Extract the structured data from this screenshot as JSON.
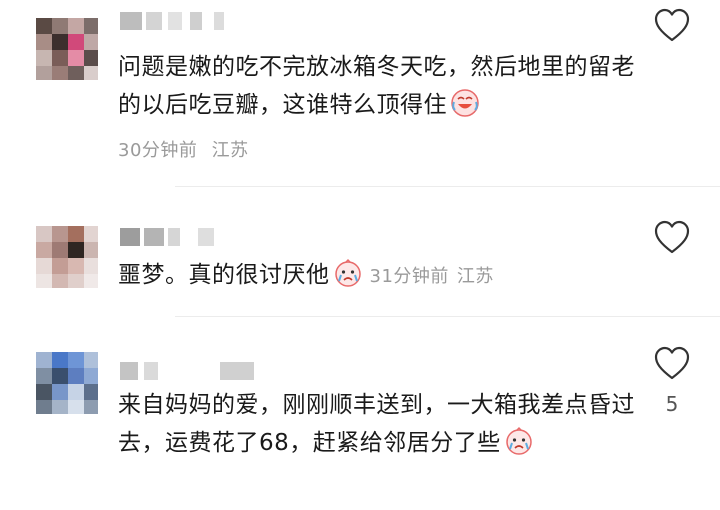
{
  "comments": [
    {
      "text": "问题是嫩的吃不完放冰箱冬天吃，然后地里的留老的以后吃豆瓣，这谁特么顶得住",
      "emoji": "crying-laughing-emoji",
      "time": "30分钟前",
      "location": "江苏",
      "likes": ""
    },
    {
      "text": "噩梦。真的很讨厌他",
      "emoji": "crying-face-emoji",
      "time": "31分钟前",
      "location": "江苏",
      "likes": ""
    },
    {
      "text": "来自妈妈的爱，刚刚顺丰送到，一大箱我差点昏过去，运费花了68，赶紧给邻居分了些",
      "emoji": "crying-face-emoji",
      "time": "",
      "location": "",
      "likes": "5"
    }
  ],
  "icons": {
    "like": "heart-outline-icon"
  },
  "colors": {
    "text": "#1a1a1a",
    "meta": "#9a9a9a",
    "divider": "#ececec"
  }
}
